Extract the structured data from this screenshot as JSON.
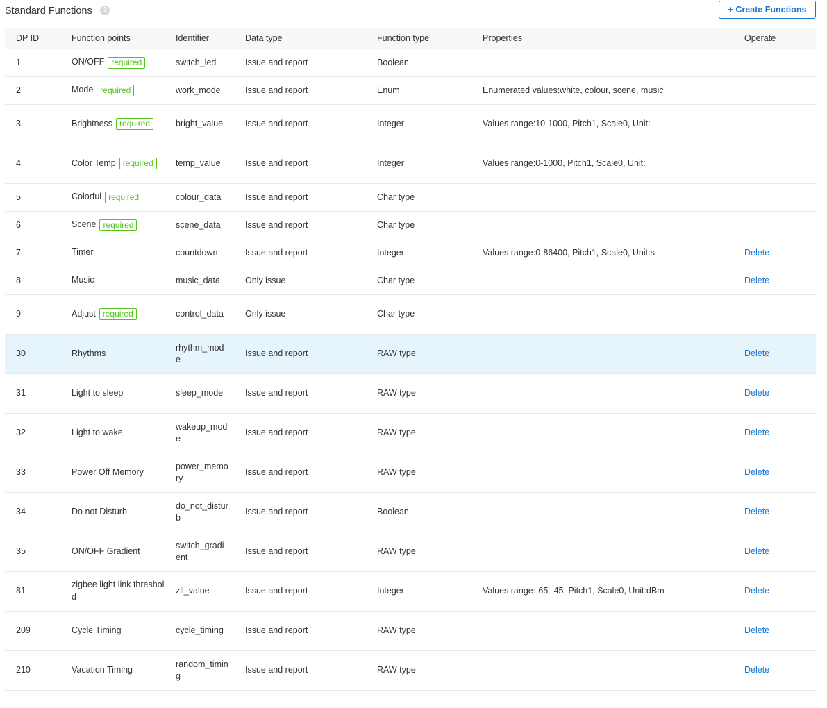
{
  "header": {
    "title": "Standard Functions",
    "help_icon": "?",
    "create_button_label": "+ Create Functions"
  },
  "table": {
    "columns": [
      "DP ID",
      "Function points",
      "Identifier",
      "Data type",
      "Function type",
      "Properties",
      "Operate"
    ],
    "required_label": "required",
    "delete_label": "Delete",
    "rows": [
      {
        "dp_id": "1",
        "function_point": "ON/OFF",
        "required": true,
        "identifier": "switch_led",
        "data_type": "Issue and report",
        "function_type": "Boolean",
        "properties": "",
        "deletable": false
      },
      {
        "dp_id": "2",
        "function_point": "Mode",
        "required": true,
        "identifier": "work_mode",
        "data_type": "Issue and report",
        "function_type": "Enum",
        "properties": "Enumerated values:white, colour, scene, music",
        "deletable": false
      },
      {
        "dp_id": "3",
        "function_point": "Brightness",
        "required": true,
        "identifier": "bright_value",
        "data_type": "Issue and report",
        "function_type": "Integer",
        "properties": "Values range:10-1000, Pitch1, Scale0, Unit:",
        "deletable": false
      },
      {
        "dp_id": "4",
        "function_point": "Color Temp",
        "required": true,
        "identifier": "temp_value",
        "data_type": "Issue and report",
        "function_type": "Integer",
        "properties": "Values range:0-1000, Pitch1, Scale0, Unit:",
        "deletable": false
      },
      {
        "dp_id": "5",
        "function_point": "Colorful",
        "required": true,
        "identifier": "colour_data",
        "data_type": "Issue and report",
        "function_type": "Char type",
        "properties": "",
        "deletable": false
      },
      {
        "dp_id": "6",
        "function_point": "Scene",
        "required": true,
        "identifier": "scene_data",
        "data_type": "Issue and report",
        "function_type": "Char type",
        "properties": "",
        "deletable": false
      },
      {
        "dp_id": "7",
        "function_point": "Timer",
        "required": false,
        "identifier": "countdown",
        "data_type": "Issue and report",
        "function_type": "Integer",
        "properties": "Values range:0-86400, Pitch1, Scale0, Unit:s",
        "deletable": true
      },
      {
        "dp_id": "8",
        "function_point": "Music",
        "required": false,
        "identifier": "music_data",
        "data_type": "Only issue",
        "function_type": "Char type",
        "properties": "",
        "deletable": true
      },
      {
        "dp_id": "9",
        "function_point": "Adjust",
        "required": true,
        "identifier": "control_data",
        "data_type": "Only issue",
        "function_type": "Char type",
        "properties": "",
        "deletable": false
      },
      {
        "dp_id": "30",
        "function_point": "Rhythms",
        "required": false,
        "identifier": "rhythm_mode",
        "data_type": "Issue and report",
        "function_type": "RAW type",
        "properties": "",
        "deletable": true
      },
      {
        "dp_id": "31",
        "function_point": "Light to sleep",
        "required": false,
        "identifier": "sleep_mode",
        "data_type": "Issue and report",
        "function_type": "RAW type",
        "properties": "",
        "deletable": true
      },
      {
        "dp_id": "32",
        "function_point": "Light to wake",
        "required": false,
        "identifier": "wakeup_mode",
        "data_type": "Issue and report",
        "function_type": "RAW type",
        "properties": "",
        "deletable": true
      },
      {
        "dp_id": "33",
        "function_point": "Power Off Memory",
        "required": false,
        "identifier": "power_memory",
        "data_type": "Issue and report",
        "function_type": "RAW type",
        "properties": "",
        "deletable": true
      },
      {
        "dp_id": "34",
        "function_point": "Do not Disturb",
        "required": false,
        "identifier": "do_not_disturb",
        "data_type": "Issue and report",
        "function_type": "Boolean",
        "properties": "",
        "deletable": true
      },
      {
        "dp_id": "35",
        "function_point": "ON/OFF Gradient",
        "required": false,
        "identifier": "switch_gradient",
        "data_type": "Issue and report",
        "function_type": "RAW type",
        "properties": "",
        "deletable": true
      },
      {
        "dp_id": "81",
        "function_point": "zigbee light link threshold",
        "required": false,
        "identifier": "zll_value",
        "data_type": "Issue and report",
        "function_type": "Integer",
        "properties": "Values range:-65--45, Pitch1, Scale0, Unit:dBm",
        "deletable": true
      },
      {
        "dp_id": "209",
        "function_point": "Cycle Timing",
        "required": false,
        "identifier": "cycle_timing",
        "data_type": "Issue and report",
        "function_type": "RAW type",
        "properties": "",
        "deletable": true
      },
      {
        "dp_id": "210",
        "function_point": "Vacation Timing",
        "required": false,
        "identifier": "random_timing",
        "data_type": "Issue and report",
        "function_type": "RAW type",
        "properties": "",
        "deletable": true
      }
    ]
  },
  "colors": {
    "accent": "#1677d2",
    "required_green": "#52c41a",
    "row_highlight": "#e6f5fc",
    "header_bg": "#f7f7f7"
  }
}
